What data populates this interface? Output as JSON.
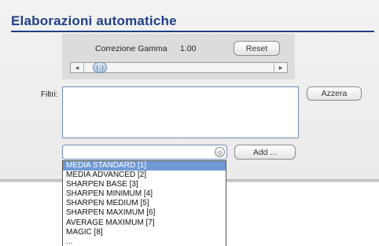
{
  "section": {
    "title": "Elaborazioni automatiche"
  },
  "gamma": {
    "label": "Correzione Gamma",
    "value": "1.00",
    "reset_label": "Reset",
    "slider_left_arrow": "◂",
    "slider_right_arrow": "▸"
  },
  "filters": {
    "label": "Filtri:",
    "list_value": "",
    "clear_label": "Azzera",
    "combo_value": "",
    "combo_arrow": "◇",
    "add_label": "Add ..."
  },
  "dropdown": {
    "items": [
      "MEDIA STANDARD [1]",
      "MEDIA ADVANCED [2]",
      "SHARPEN BASE [3]",
      "SHARPEN MINIMUM [4]",
      "SHARPEN MEDIUM [5]",
      "SHARPEN MAXIMUM [6]",
      "AVERAGE MAXIMUM [7]",
      "MAGIC [8]",
      "..."
    ],
    "selected_index": 0
  }
}
